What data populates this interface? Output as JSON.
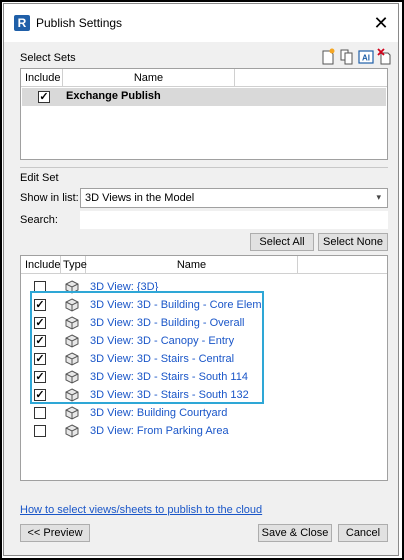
{
  "window": {
    "title": "Publish Settings",
    "app_icon_letter": "R",
    "close_glyph": "✕"
  },
  "select_sets": {
    "label": "Select Sets",
    "toolbar_icons": [
      "new-set-icon",
      "duplicate-set-icon",
      "rename-set-icon",
      "delete-set-icon"
    ],
    "columns": [
      "Include",
      "Name"
    ],
    "rows": [
      {
        "checked": true,
        "name": "Exchange Publish"
      }
    ]
  },
  "edit_set": {
    "label": "Edit Set",
    "show_in_list_label": "Show in list:",
    "show_in_list_value": "3D Views in the Model",
    "search_label": "Search:",
    "search_value": "",
    "select_all_label": "Select All",
    "select_none_label": "Select None",
    "columns": [
      "Include",
      "Type",
      "Name"
    ],
    "views": [
      {
        "checked": false,
        "name": "3D View: {3D}"
      },
      {
        "checked": true,
        "name": "3D View: 3D - Building - Core Elem"
      },
      {
        "checked": true,
        "name": "3D View: 3D - Building - Overall"
      },
      {
        "checked": true,
        "name": "3D View: 3D - Canopy - Entry"
      },
      {
        "checked": true,
        "name": "3D View: 3D - Stairs - Central"
      },
      {
        "checked": true,
        "name": "3D View: 3D - Stairs - South 114"
      },
      {
        "checked": true,
        "name": "3D View: 3D - Stairs - South 132"
      },
      {
        "checked": false,
        "name": "3D View: Building Courtyard"
      },
      {
        "checked": false,
        "name": "3D View: From Parking Area"
      }
    ]
  },
  "footer": {
    "help_link": "How to select views/sheets to publish to the cloud",
    "preview_label": "<< Preview",
    "save_close_label": "Save & Close",
    "cancel_label": "Cancel"
  },
  "colors": {
    "highlight": "#2ea7d6",
    "link": "#1a56c8",
    "selected_row": "#d9d9d9"
  }
}
